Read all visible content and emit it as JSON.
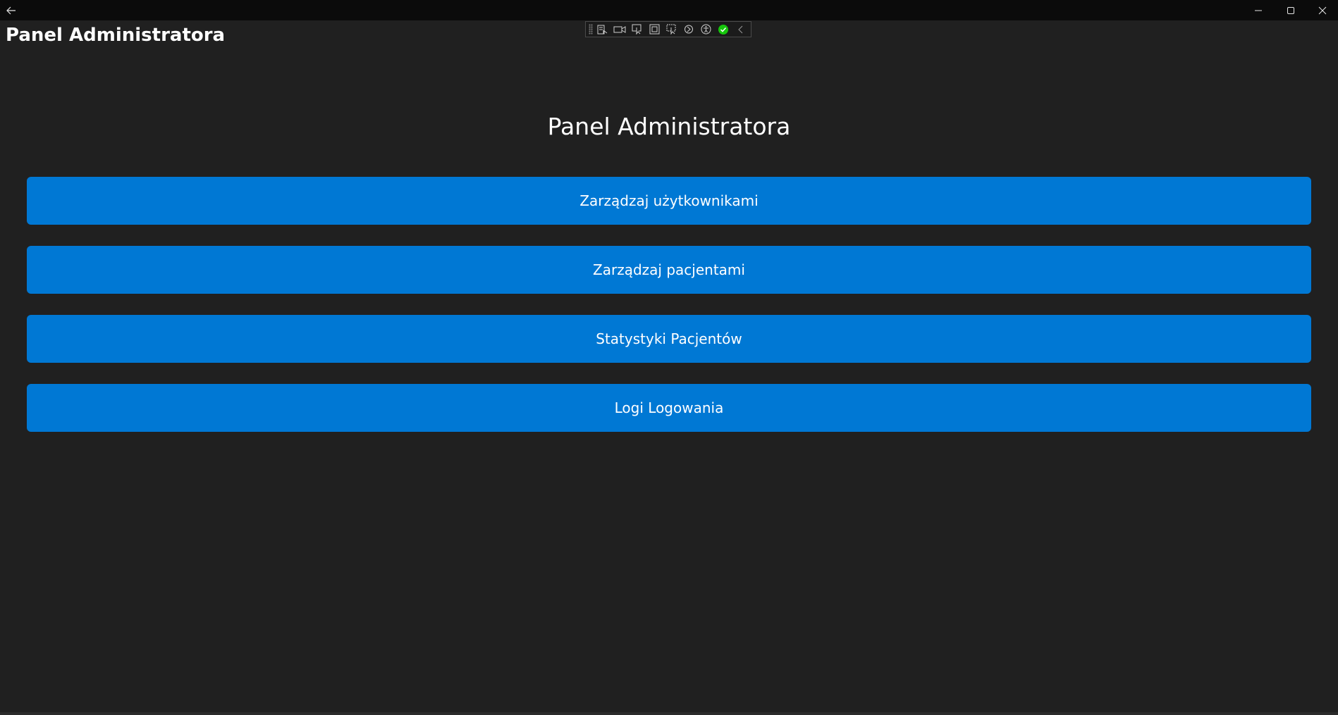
{
  "window": {
    "back_icon": "back-arrow-icon",
    "minimize_icon": "minimize-icon",
    "maximize_icon": "maximize-icon",
    "close_icon": "close-icon"
  },
  "app": {
    "title": "Panel Administratora"
  },
  "debug_toolbar": {
    "icons": [
      "live-visual-tree-icon",
      "record-icon",
      "select-element-icon",
      "display-layout-adorners-icon",
      "track-focus-icon",
      "hot-reload-icon",
      "accessibility-icon",
      "status-ok-icon",
      "collapse-icon"
    ]
  },
  "main": {
    "heading": "Panel Administratora",
    "buttons": [
      {
        "label": "Zarządzaj użytkownikami"
      },
      {
        "label": "Zarządzaj pacjentami"
      },
      {
        "label": "Statystyki Pacjentów"
      },
      {
        "label": "Logi Logowania"
      }
    ]
  },
  "colors": {
    "background": "#202020",
    "titlebar": "#0b0b0b",
    "accent": "#0078d4",
    "text": "#ffffff",
    "status_ok": "#16c60c"
  }
}
